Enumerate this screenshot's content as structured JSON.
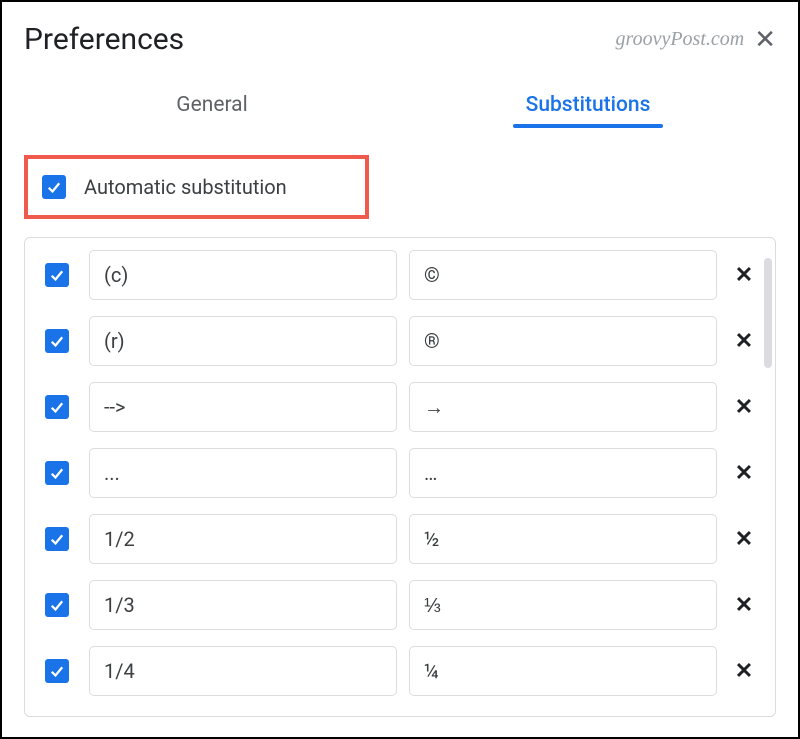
{
  "dialog": {
    "title": "Preferences",
    "watermark": "groovyPost.com"
  },
  "tabs": {
    "general": "General",
    "substitutions": "Substitutions"
  },
  "autoSub": {
    "label": "Automatic substitution",
    "checked": true
  },
  "substitutions": [
    {
      "checked": true,
      "replace": "(c)",
      "with": "©"
    },
    {
      "checked": true,
      "replace": "(r)",
      "with": "®"
    },
    {
      "checked": true,
      "replace": "-->",
      "with": "→"
    },
    {
      "checked": true,
      "replace": "...",
      "with": "…"
    },
    {
      "checked": true,
      "replace": "1/2",
      "with": "½"
    },
    {
      "checked": true,
      "replace": "1/3",
      "with": "⅓"
    },
    {
      "checked": true,
      "replace": "1/4",
      "with": "¼"
    }
  ]
}
